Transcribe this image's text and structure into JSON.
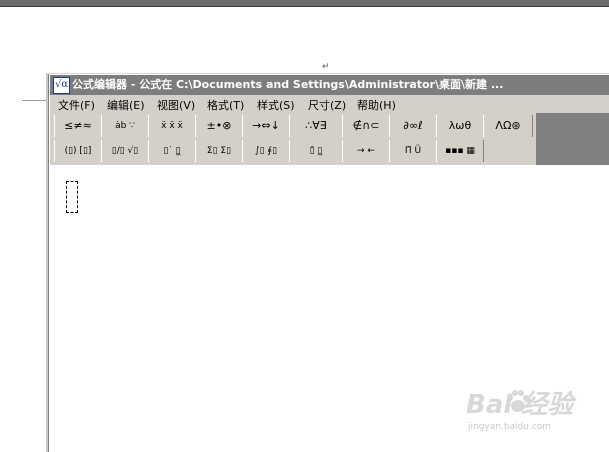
{
  "document": {
    "paragraph_mark": "↵"
  },
  "window": {
    "icon_glyph": "√α",
    "title": "公式编辑器 - 公式在 C:\\Documents and Settings\\Administrator\\桌面\\新建 ..."
  },
  "menu": [
    {
      "label": "文件(F)",
      "id": "file"
    },
    {
      "label": "编辑(E)",
      "id": "edit"
    },
    {
      "label": "视图(V)",
      "id": "view"
    },
    {
      "label": "格式(T)",
      "id": "format"
    },
    {
      "label": "样式(S)",
      "id": "style"
    },
    {
      "label": "尺寸(Z)",
      "id": "size"
    },
    {
      "label": "帮助(H)",
      "id": "help"
    }
  ],
  "toolbar": {
    "row1": [
      {
        "label": "≤≠≈",
        "id": "relational"
      },
      {
        "label": "ȧb ∵",
        "id": "spaces-ellipses"
      },
      {
        "label": "ẍ ẍ ẍ",
        "id": "embellishments"
      },
      {
        "label": "±•⊗",
        "id": "operators"
      },
      {
        "label": "→⇔↓",
        "id": "arrows"
      },
      {
        "label": "∴∀∃",
        "id": "logical"
      },
      {
        "label": "∉∩⊂",
        "id": "set-theory"
      },
      {
        "label": "∂∞ℓ",
        "id": "misc-symbols"
      },
      {
        "label": "λωθ",
        "id": "greek-lower"
      },
      {
        "label": "ΛΩ⊛",
        "id": "greek-upper"
      }
    ],
    "row2": [
      {
        "label": "(▯) [▯]",
        "id": "fence-templates"
      },
      {
        "label": "▯/▯ √▯",
        "id": "fraction-radical"
      },
      {
        "label": "▯˙ ▯̲",
        "id": "script-templates"
      },
      {
        "label": "Σ▯ Σ▯",
        "id": "summation"
      },
      {
        "label": "∫▯ ∮▯",
        "id": "integral"
      },
      {
        "label": "▯̄ ▯̲",
        "id": "bar-templates"
      },
      {
        "label": "→ ←",
        "id": "labeled-arrows"
      },
      {
        "label": "Π̈ Ü",
        "id": "products-sets"
      },
      {
        "label": "▪▪▪ ▦",
        "id": "matrix"
      }
    ]
  },
  "watermark": {
    "brand": "Bai  经验",
    "url": "jingyan.baidu.com"
  }
}
